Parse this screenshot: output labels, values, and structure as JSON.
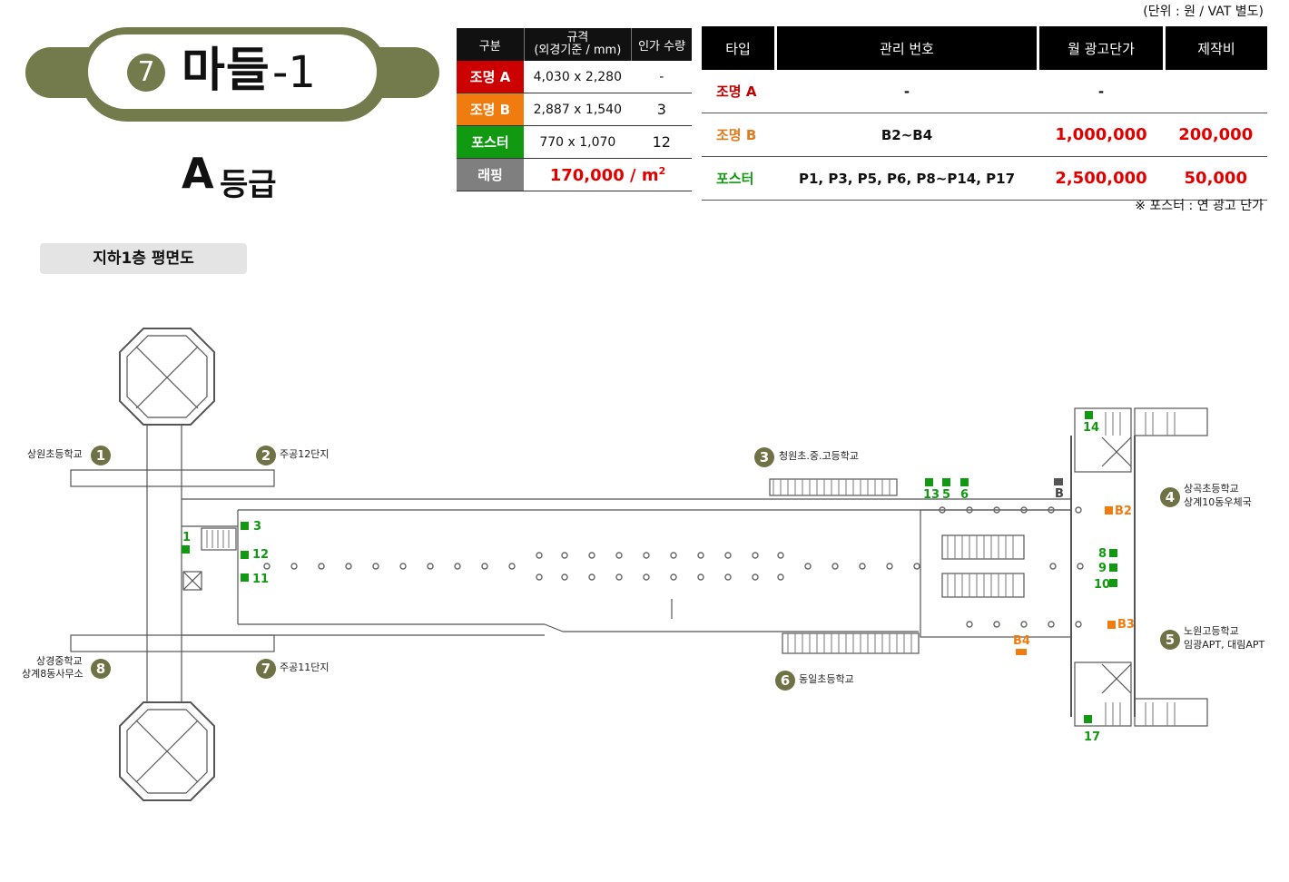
{
  "title": {
    "number": "7",
    "name": "마들",
    "suffix": "-1",
    "grade_letter": "A",
    "grade_text": "등급"
  },
  "unit_note": "(단위 : 원 / VAT 별도)",
  "spec_table": {
    "headers": [
      "구분",
      "규격",
      "(외경기준 / mm)",
      "인가 수량"
    ],
    "rows": [
      {
        "category": "조명 A",
        "color": "#cc0000",
        "size": "4,030 x 2,280",
        "qty": "-"
      },
      {
        "category": "조명 B",
        "color": "#f07c10",
        "size": "2,887 x 1,540",
        "qty": "3"
      },
      {
        "category": "포스터",
        "color": "#119911",
        "size": "770 x 1,070",
        "qty": "12"
      }
    ],
    "wrap": {
      "category": "래핑",
      "color": "#7f7f7f",
      "price": "170,000 / m",
      "unit_sup": "2"
    }
  },
  "price_table": {
    "headers": [
      "타입",
      "관리 번호",
      "월 광고단가",
      "제작비"
    ],
    "rows": [
      {
        "type": "조명 A",
        "color": "#c00000",
        "codes": "-",
        "monthly": "-",
        "production": ""
      },
      {
        "type": "조명 B",
        "color": "#e07b20",
        "codes": "B2~B4",
        "monthly": "1,000,000",
        "production": "200,000"
      },
      {
        "type": "포스터",
        "color": "#119911",
        "codes": "P1, P3, P5, P6, P8~P14, P17",
        "monthly": "2,500,000",
        "production": "50,000"
      }
    ],
    "note": "※ 포스터 : 연 광고 단가"
  },
  "floor_label": "지하1층 평면도",
  "map": {
    "exits": [
      {
        "num": "1",
        "name": "상원초등학교"
      },
      {
        "num": "2",
        "name": "주공12단지"
      },
      {
        "num": "3",
        "name": "청원초.중.고등학교"
      },
      {
        "num": "4",
        "name": "상곡초등학교",
        "name2": "상계10동우체국"
      },
      {
        "num": "5",
        "name": "노원고등학교",
        "name2": "임광APT, 대림APT"
      },
      {
        "num": "6",
        "name": "동일초등학교"
      },
      {
        "num": "7",
        "name": "주공11단지"
      },
      {
        "num": "8",
        "name": "상경중학교",
        "name2": "상계8동사무소"
      }
    ],
    "poster_markers": [
      "1",
      "3",
      "12",
      "11",
      "13",
      "5",
      "6",
      "14",
      "8",
      "9",
      "10",
      "17"
    ],
    "light_markers": [
      "B2",
      "B3",
      "B4"
    ],
    "grey_marker": "B"
  }
}
